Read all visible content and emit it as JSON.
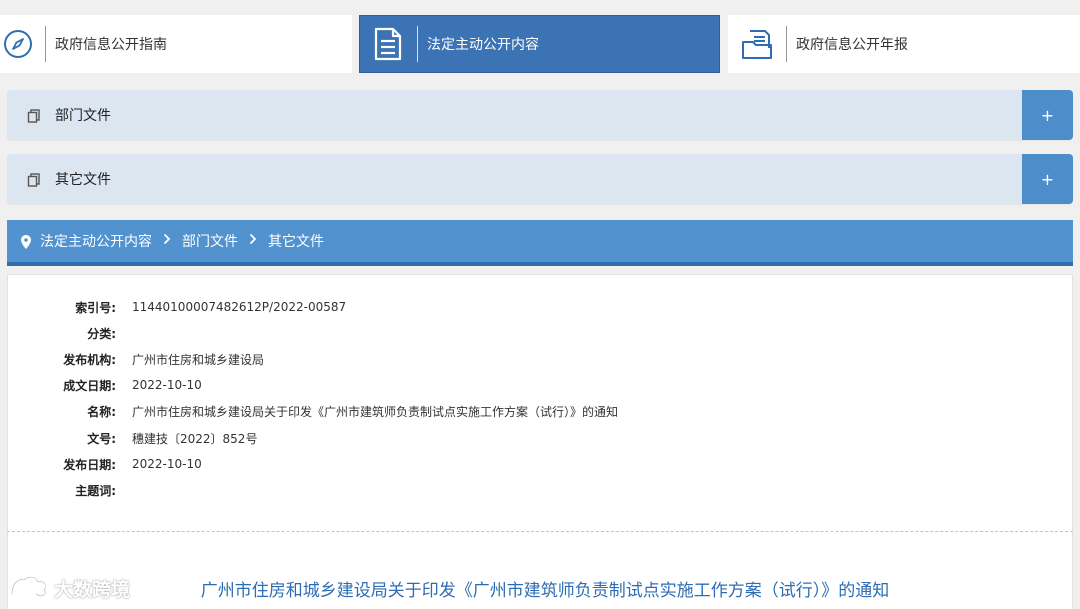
{
  "tabs": [
    {
      "label": "政府信息公开指南",
      "icon": "compass-icon",
      "active": false
    },
    {
      "label": "法定主动公开内容",
      "icon": "document-icon",
      "active": true
    },
    {
      "label": "政府信息公开年报",
      "icon": "folder-docs-icon",
      "active": false
    }
  ],
  "panels": [
    {
      "label": "部门文件",
      "toggle": "+"
    },
    {
      "label": "其它文件",
      "toggle": "+"
    }
  ],
  "breadcrumb": {
    "items": [
      "法定主动公开内容",
      "部门文件",
      "其它文件"
    ],
    "separator": ">"
  },
  "meta": [
    {
      "key": "索引号:",
      "value": "11440100007482612P/2022-00587"
    },
    {
      "key": "分类:",
      "value": ""
    },
    {
      "key": "发布机构:",
      "value": "广州市住房和城乡建设局"
    },
    {
      "key": "成文日期:",
      "value": "2022-10-10"
    },
    {
      "key": "名称:",
      "value": "广州市住房和城乡建设局关于印发《广州市建筑师负责制试点实施工作方案（试行）》的通知"
    },
    {
      "key": "文号:",
      "value": "穗建技〔2022〕852号"
    },
    {
      "key": "发布日期:",
      "value": "2022-10-10"
    },
    {
      "key": "主题词:",
      "value": ""
    }
  ],
  "document": {
    "title": "广州市住房和城乡建设局关于印发《广州市建筑师负责制试点实施工作方案（试行）》的通知"
  },
  "watermark": {
    "text": "大数跨境"
  },
  "colors": {
    "active_tab": "#3c73b4",
    "panel_bg": "#dce6f1",
    "panel_toggle": "#4d8dc9",
    "breadcrumb_bg": "#5293cf",
    "title_blue": "#2e6db3"
  }
}
